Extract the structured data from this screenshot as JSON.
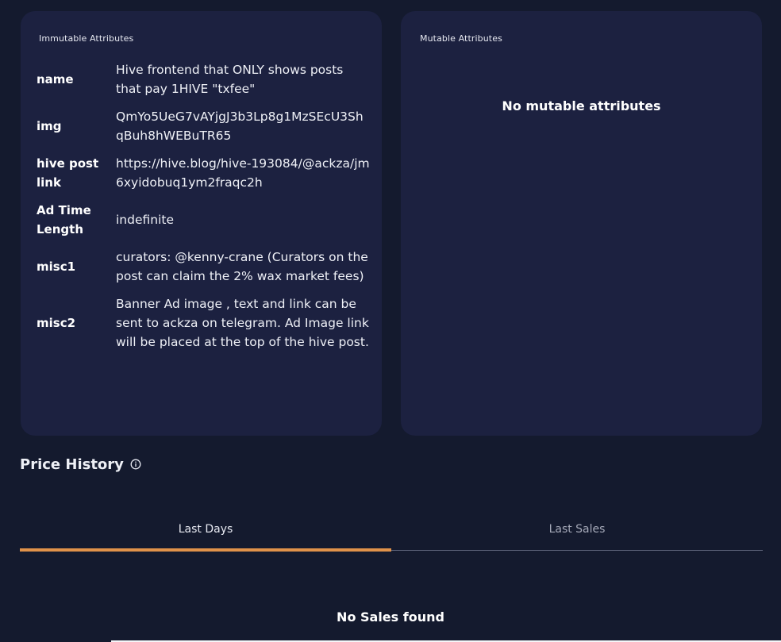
{
  "immutable": {
    "title": "Immutable Attributes",
    "rows": [
      {
        "key": "name",
        "value": "Hive frontend that ONLY shows posts that pay 1HIVE \"txfee\""
      },
      {
        "key": "img",
        "value": "QmYo5UeG7vAYjgJ3b3Lp8g1MzSEcU3ShqBuh8hWEBuTR65"
      },
      {
        "key": "hive post link",
        "value": "https://hive.blog/hive-193084/@ackza/jm6xyidobuq1ym2fraqc2h"
      },
      {
        "key": "Ad Time Length",
        "value": "indefinite"
      },
      {
        "key": "misc1",
        "value": "curators: @kenny-crane (Curators on the post can claim the 2% wax market fees)"
      },
      {
        "key": "misc2",
        "value": "Banner Ad image , text and link can be sent to ackza on telegram. Ad Image link will be placed at the top of the hive post."
      }
    ]
  },
  "mutable": {
    "title": "Mutable Attributes",
    "empty_text": "No mutable attributes"
  },
  "price_history": {
    "title": "Price History",
    "info_icon": "info-icon",
    "tabs": [
      {
        "label": "Last Days",
        "active": true
      },
      {
        "label": "Last Sales",
        "active": false
      }
    ],
    "empty_text": "No Sales found"
  },
  "colors": {
    "background": "#141a2e",
    "card": "#1c2140",
    "accent": "#e0924a"
  }
}
